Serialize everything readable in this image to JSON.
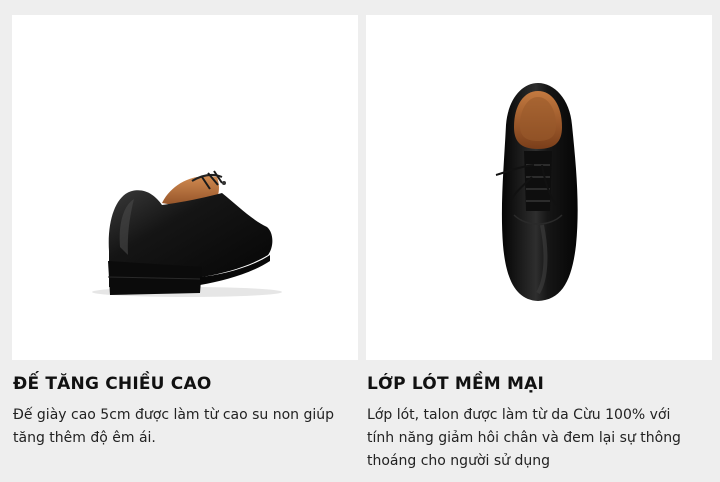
{
  "features": [
    {
      "title": "ĐẾ TĂNG CHIỀU CAO",
      "description": "Đế giày cao 5cm được làm từ cao su non giúp tăng thêm độ êm ái.",
      "image_icon": "shoe-rear-view-icon"
    },
    {
      "title": "LỚP LÓT MỀM MẠI",
      "description": "Lớp lót, talon được làm từ da Cừu 100% với tính năng giảm hôi chân và đem lại sự thông thoáng cho người sử dụng",
      "image_icon": "shoe-top-view-icon"
    }
  ],
  "colors": {
    "page_background": "#eeeeee",
    "card_background": "#ffffff",
    "shoe_leather": "#111111",
    "shoe_lining": "#b06a3a"
  }
}
